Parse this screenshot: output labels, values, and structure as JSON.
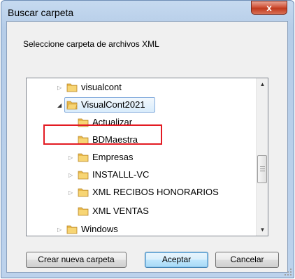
{
  "dialog": {
    "title": "Buscar carpeta",
    "close_symbol": "x",
    "prompt": "Seleccione carpeta de archivos XML"
  },
  "tree": {
    "items": [
      {
        "label": "visualcont",
        "expander": "collapsed"
      },
      {
        "label": "VisualCont2021",
        "expander": "expanded",
        "selected": true
      },
      {
        "label": "Actualizar",
        "expander": "none"
      },
      {
        "label": "BDMaestra",
        "expander": "none"
      },
      {
        "label": "Empresas",
        "expander": "collapsed"
      },
      {
        "label": "INSTALLL-VC",
        "expander": "collapsed"
      },
      {
        "label": "XML RECIBOS HONORARIOS",
        "expander": "collapsed"
      },
      {
        "label": "XML VENTAS",
        "expander": "none",
        "highlighted": true
      },
      {
        "label": "Windows",
        "expander": "collapsed"
      }
    ],
    "highlight_color": "#e31b23"
  },
  "buttons": {
    "new_folder": "Crear nueva carpeta",
    "accept": "Aceptar",
    "cancel": "Cancelar"
  }
}
